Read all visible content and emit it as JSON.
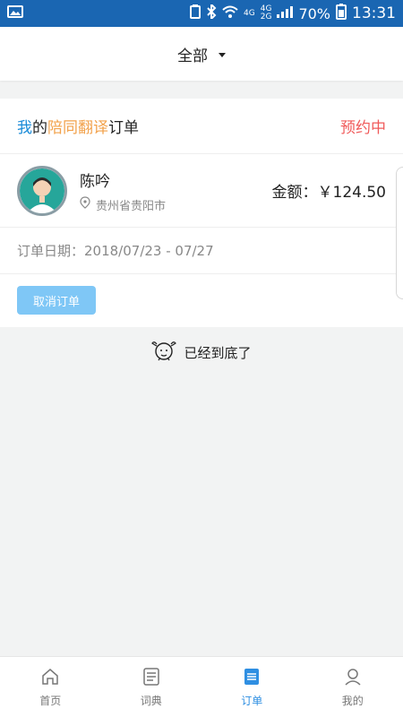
{
  "status_bar": {
    "net_top": "4G",
    "net_mid_a": "4G",
    "net_mid_b": "2G",
    "battery": "70%",
    "time": "13:31"
  },
  "header": {
    "filter_label": "全部"
  },
  "order_card": {
    "title_part_a": "我",
    "title_part_b": "的",
    "title_part_c": "陪同翻译",
    "title_part_d": "订单",
    "status": "预约中",
    "person_name": "陈吟",
    "location": "贵州省贵阳市",
    "amount": "金额：￥124.50",
    "date": "订单日期：2018/07/23 - 07/27",
    "cancel_label": "取消订单"
  },
  "end_note": "已经到底了",
  "colors": {
    "status_bar": "#1a66b2",
    "accent_blue": "#1a8bd8",
    "accent_orange": "#f2a14a",
    "status_red": "#f05a5a",
    "button_light_blue": "#7fc7f6",
    "nav_active": "#2f8fe2"
  },
  "bottom_nav": {
    "items": [
      {
        "label": "首页",
        "icon": "home-icon"
      },
      {
        "label": "词典",
        "icon": "dictionary-icon"
      },
      {
        "label": "订单",
        "icon": "orders-icon"
      },
      {
        "label": "我的",
        "icon": "profile-icon"
      }
    ],
    "active_index": 2
  }
}
